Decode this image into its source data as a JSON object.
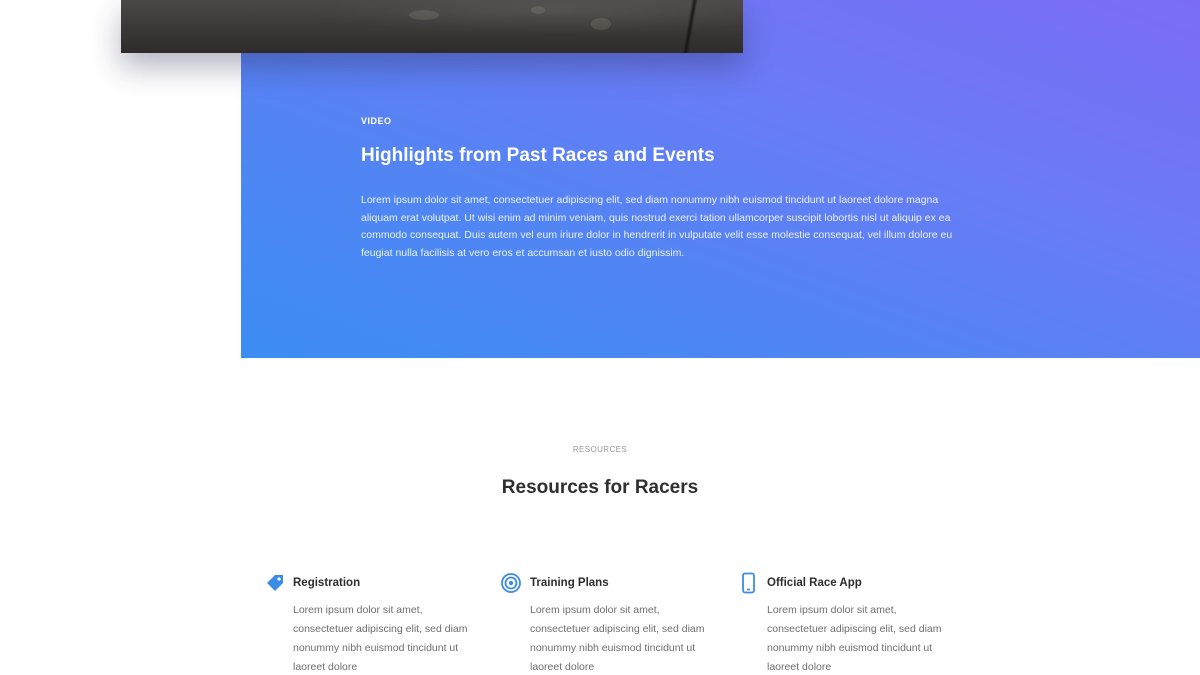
{
  "video": {
    "eyebrow": "VIDEO",
    "heading": "Highlights from Past Races and Events",
    "body": "Lorem ipsum dolor sit amet, consectetuer adipiscing elit, sed diam nonummy nibh euismod tincidunt ut laoreet dolore magna aliquam erat volutpat. Ut wisi enim ad minim veniam, quis nostrud exerci tation ullamcorper suscipit lobortis nisl ut aliquip ex ea commodo consequat. Duis autem vel eum iriure dolor in hendrerit in vulputate velit esse molestie consequat, vel illum dolore eu feugiat nulla facilisis at vero eros et accumsan et iusto odio dignissim."
  },
  "resources": {
    "eyebrow": "RESOURCES",
    "heading": "Resources for Racers",
    "items": [
      {
        "icon": "tag-icon",
        "title": "Registration",
        "text": "Lorem ipsum dolor sit amet, consectetuer adipiscing elit, sed diam nonummy nibh euismod tincidunt ut laoreet dolore"
      },
      {
        "icon": "target-icon",
        "title": "Training Plans",
        "text": "Lorem ipsum dolor sit amet, consectetuer adipiscing elit, sed diam nonummy nibh euismod tincidunt ut laoreet dolore"
      },
      {
        "icon": "mobile-phone-icon",
        "title": "Official Race App",
        "text": "Lorem ipsum dolor sit amet, consectetuer adipiscing elit, sed diam nonummy nibh euismod tincidunt ut laoreet dolore"
      }
    ]
  },
  "colors": {
    "gradient_top": "#7b6cf6",
    "gradient_bottom": "#3b8cf3",
    "icon_accent": "#3d8be8",
    "heading_text": "#2f2f2f"
  }
}
